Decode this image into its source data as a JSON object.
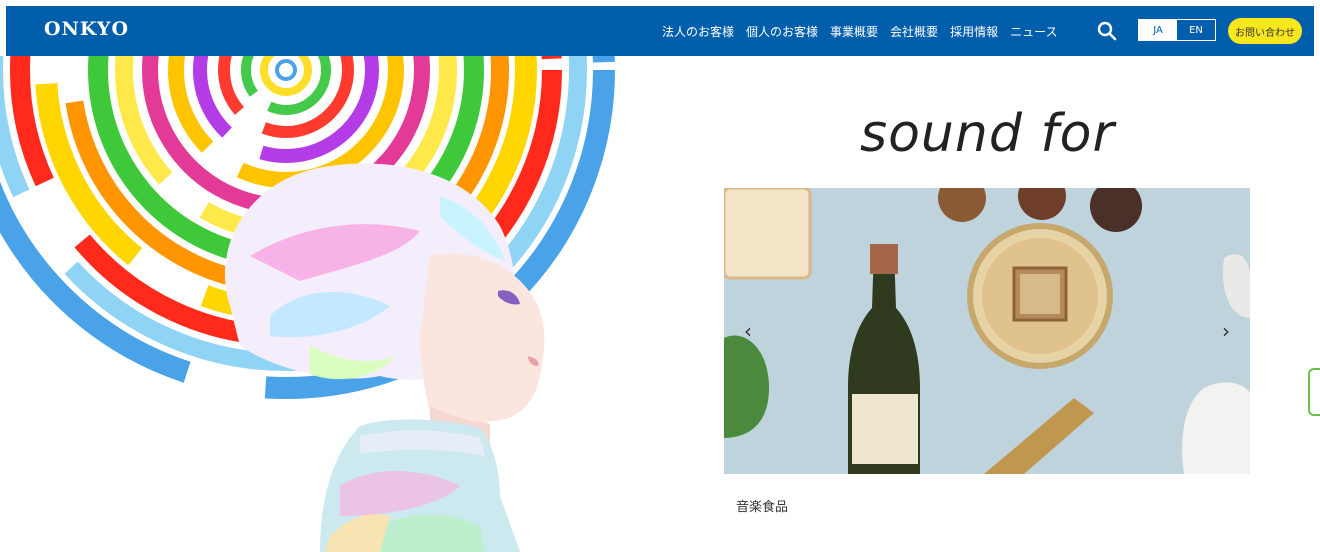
{
  "header": {
    "logo": "ONKYO",
    "nav": [
      "法人のお客様",
      "個人のお客様",
      "事業概要",
      "会社概要",
      "採用情報",
      "ニュース"
    ],
    "lang": {
      "ja": "JA",
      "en": "EN"
    },
    "contact": "お問い合わせ",
    "icons": {
      "search": "search-icon"
    }
  },
  "hero": {
    "tagline": "sound for",
    "slide_caption": "音楽食品",
    "prev": "‹",
    "next": "›"
  },
  "colors": {
    "header_bg": "#005eab",
    "accent_yellow": "#f8e71c"
  }
}
